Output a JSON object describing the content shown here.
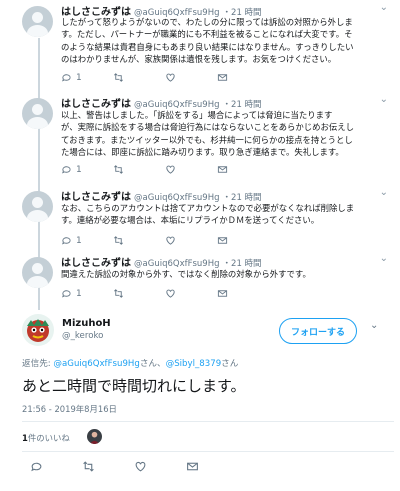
{
  "tweets": [
    {
      "name": "",
      "handle": "",
      "time": "",
      "text": "したがって怒りようがないので、わたしの分に限っては訴訟の対照から外しま\nす。ただし、パートナーが職業的にも不利益を被ることになれば大変です。そ\nのような結果は貴君自身にもあまり良い結果にはなりません。すっきりしたい\nのはわかりませんが、家族関係は遺恨を残します。お気をつけください。",
      "reply_count": "1",
      "like_count": ""
    },
    {
      "name": "はしさこみずは",
      "handle": "@aGuiq6QxfFsu9Hg",
      "time": "・21 時間",
      "text": "以上、警告はしました。「訴訟をする」場合によっては脅迫に当たります\nが、実際に訴訟をする場合は脅迫行為にはならないことをあらかじめお伝えし\nておきます。またツイッター以外でも、杉井純一に何らかの接点を持とうとし\nた場合には、即座に訴訟に踏み切ります。取り急ぎ連絡まで。失礼します。",
      "reply_count": "1",
      "like_count": ""
    },
    {
      "name": "はしさこみずは",
      "handle": "@aGuiq6QxfFsu9Hg",
      "time": "・21 時間",
      "text": "なお、こちらのアカウントは捨てアカウントなので必要がなくなれば削除しま\nす。連絡が必要な場合は、本垢にリプライかＤＭを送ってください。",
      "reply_count": "1",
      "like_count": ""
    },
    {
      "name": "はしさこみずは",
      "handle": "@aGuiq6QxfFsu9Hg",
      "time": "・21 時間",
      "text": "間違えた訴訟の対象から外す、ではなく削除の対象から外すです。",
      "reply_count": "1",
      "like_count": ""
    }
  ],
  "first_header": {
    "name": "はしさこみずは",
    "handle": "@aGuiq6QxfFsu9Hg",
    "time": "・21 時間"
  },
  "main": {
    "name": "MizuhoH",
    "handle": "@_keroko",
    "follow_label": "フォローする",
    "reply_prefix": "返信先: ",
    "reply_user1": "@aGuiq6QxfFsu9Hg",
    "reply_sep": "さん、",
    "reply_user2": "@Sibyl_8379",
    "reply_suffix": "さん",
    "text": "あと二時間で時間切れにします。",
    "datetime": "21:56 - 2019年8月16日",
    "likes_count": "1",
    "likes_label": "件のいいね"
  },
  "colors": {
    "accent": "#1da1f2",
    "muted": "#657786",
    "thread_line": "#ccd6dd"
  }
}
